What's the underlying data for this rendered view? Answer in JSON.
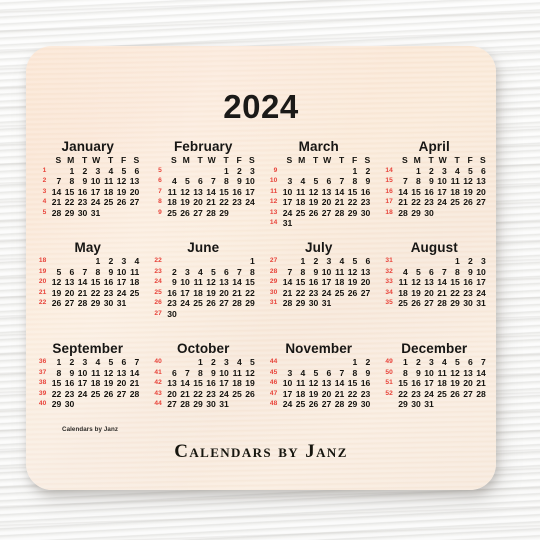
{
  "product": {
    "type": "mouse-pad",
    "pad_color": "#faead9",
    "background": "#f4f4f2"
  },
  "calendar": {
    "year": "2024",
    "week_number_color": "#e8433a",
    "text_color": "#14130f",
    "weekday_headers": [
      "S",
      "M",
      "T",
      "W",
      "T",
      "F",
      "S"
    ],
    "months": [
      {
        "name": "January",
        "show_weekday_header": true,
        "weeks": [
          {
            "num": "1",
            "days": [
              "",
              "1",
              "2",
              "3",
              "4",
              "5",
              "6"
            ]
          },
          {
            "num": "2",
            "days": [
              "7",
              "8",
              "9",
              "10",
              "11",
              "12",
              "13"
            ]
          },
          {
            "num": "3",
            "days": [
              "14",
              "15",
              "16",
              "17",
              "18",
              "19",
              "20"
            ]
          },
          {
            "num": "4",
            "days": [
              "21",
              "22",
              "23",
              "24",
              "25",
              "26",
              "27"
            ]
          },
          {
            "num": "5",
            "days": [
              "28",
              "29",
              "30",
              "31",
              "",
              "",
              ""
            ]
          }
        ]
      },
      {
        "name": "February",
        "show_weekday_header": true,
        "weeks": [
          {
            "num": "5",
            "days": [
              "",
              "",
              "",
              "",
              "1",
              "2",
              "3"
            ]
          },
          {
            "num": "6",
            "days": [
              "4",
              "5",
              "6",
              "7",
              "8",
              "9",
              "10"
            ]
          },
          {
            "num": "7",
            "days": [
              "11",
              "12",
              "13",
              "14",
              "15",
              "16",
              "17"
            ]
          },
          {
            "num": "8",
            "days": [
              "18",
              "19",
              "20",
              "21",
              "22",
              "23",
              "24"
            ]
          },
          {
            "num": "9",
            "days": [
              "25",
              "26",
              "27",
              "28",
              "29",
              "",
              ""
            ]
          }
        ]
      },
      {
        "name": "March",
        "show_weekday_header": true,
        "weeks": [
          {
            "num": "9",
            "days": [
              "",
              "",
              "",
              "",
              "",
              "1",
              "2"
            ]
          },
          {
            "num": "10",
            "days": [
              "3",
              "4",
              "5",
              "6",
              "7",
              "8",
              "9"
            ]
          },
          {
            "num": "11",
            "days": [
              "10",
              "11",
              "12",
              "13",
              "14",
              "15",
              "16"
            ]
          },
          {
            "num": "12",
            "days": [
              "17",
              "18",
              "19",
              "20",
              "21",
              "22",
              "23"
            ]
          },
          {
            "num": "13",
            "days": [
              "24",
              "25",
              "26",
              "27",
              "28",
              "29",
              "30"
            ]
          },
          {
            "num": "14",
            "days": [
              "31",
              "",
              "",
              "",
              "",
              "",
              ""
            ]
          }
        ]
      },
      {
        "name": "April",
        "show_weekday_header": true,
        "weeks": [
          {
            "num": "14",
            "days": [
              "",
              "1",
              "2",
              "3",
              "4",
              "5",
              "6"
            ]
          },
          {
            "num": "15",
            "days": [
              "7",
              "8",
              "9",
              "10",
              "11",
              "12",
              "13"
            ]
          },
          {
            "num": "16",
            "days": [
              "14",
              "15",
              "16",
              "17",
              "18",
              "19",
              "20"
            ]
          },
          {
            "num": "17",
            "days": [
              "21",
              "22",
              "23",
              "24",
              "25",
              "26",
              "27"
            ]
          },
          {
            "num": "18",
            "days": [
              "28",
              "29",
              "30",
              "",
              "",
              "",
              ""
            ]
          }
        ]
      },
      {
        "name": "May",
        "show_weekday_header": false,
        "weeks": [
          {
            "num": "18",
            "days": [
              "",
              "",
              "",
              "1",
              "2",
              "3",
              "4"
            ]
          },
          {
            "num": "19",
            "days": [
              "5",
              "6",
              "7",
              "8",
              "9",
              "10",
              "11"
            ]
          },
          {
            "num": "20",
            "days": [
              "12",
              "13",
              "14",
              "15",
              "16",
              "17",
              "18"
            ]
          },
          {
            "num": "21",
            "days": [
              "19",
              "20",
              "21",
              "22",
              "23",
              "24",
              "25"
            ]
          },
          {
            "num": "22",
            "days": [
              "26",
              "27",
              "28",
              "29",
              "30",
              "31",
              ""
            ]
          }
        ]
      },
      {
        "name": "June",
        "show_weekday_header": false,
        "weeks": [
          {
            "num": "22",
            "days": [
              "",
              "",
              "",
              "",
              "",
              "",
              "1"
            ]
          },
          {
            "num": "23",
            "days": [
              "2",
              "3",
              "4",
              "5",
              "6",
              "7",
              "8"
            ]
          },
          {
            "num": "24",
            "days": [
              "9",
              "10",
              "11",
              "12",
              "13",
              "14",
              "15"
            ]
          },
          {
            "num": "25",
            "days": [
              "16",
              "17",
              "18",
              "19",
              "20",
              "21",
              "22"
            ]
          },
          {
            "num": "26",
            "days": [
              "23",
              "24",
              "25",
              "26",
              "27",
              "28",
              "29"
            ]
          },
          {
            "num": "27",
            "days": [
              "30",
              "",
              "",
              "",
              "",
              "",
              ""
            ]
          }
        ]
      },
      {
        "name": "July",
        "show_weekday_header": false,
        "weeks": [
          {
            "num": "27",
            "days": [
              "",
              "1",
              "2",
              "3",
              "4",
              "5",
              "6"
            ]
          },
          {
            "num": "28",
            "days": [
              "7",
              "8",
              "9",
              "10",
              "11",
              "12",
              "13"
            ]
          },
          {
            "num": "29",
            "days": [
              "14",
              "15",
              "16",
              "17",
              "18",
              "19",
              "20"
            ]
          },
          {
            "num": "30",
            "days": [
              "21",
              "22",
              "23",
              "24",
              "25",
              "26",
              "27"
            ]
          },
          {
            "num": "31",
            "days": [
              "28",
              "29",
              "30",
              "31",
              "",
              "",
              ""
            ]
          }
        ]
      },
      {
        "name": "August",
        "show_weekday_header": false,
        "weeks": [
          {
            "num": "31",
            "days": [
              "",
              "",
              "",
              "",
              "1",
              "2",
              "3"
            ]
          },
          {
            "num": "32",
            "days": [
              "4",
              "5",
              "6",
              "7",
              "8",
              "9",
              "10"
            ]
          },
          {
            "num": "33",
            "days": [
              "11",
              "12",
              "13",
              "14",
              "15",
              "16",
              "17"
            ]
          },
          {
            "num": "34",
            "days": [
              "18",
              "19",
              "20",
              "21",
              "22",
              "23",
              "24"
            ]
          },
          {
            "num": "35",
            "days": [
              "25",
              "26",
              "27",
              "28",
              "29",
              "30",
              "31"
            ]
          }
        ]
      },
      {
        "name": "September",
        "show_weekday_header": false,
        "weeks": [
          {
            "num": "36",
            "days": [
              "1",
              "2",
              "3",
              "4",
              "5",
              "6",
              "7"
            ]
          },
          {
            "num": "37",
            "days": [
              "8",
              "9",
              "10",
              "11",
              "12",
              "13",
              "14"
            ]
          },
          {
            "num": "38",
            "days": [
              "15",
              "16",
              "17",
              "18",
              "19",
              "20",
              "21"
            ]
          },
          {
            "num": "39",
            "days": [
              "22",
              "23",
              "24",
              "25",
              "26",
              "27",
              "28"
            ]
          },
          {
            "num": "40",
            "days": [
              "29",
              "30",
              "",
              "",
              "",
              "",
              ""
            ]
          }
        ]
      },
      {
        "name": "October",
        "show_weekday_header": false,
        "weeks": [
          {
            "num": "40",
            "days": [
              "",
              "",
              "1",
              "2",
              "3",
              "4",
              "5"
            ]
          },
          {
            "num": "41",
            "days": [
              "6",
              "7",
              "8",
              "9",
              "10",
              "11",
              "12"
            ]
          },
          {
            "num": "42",
            "days": [
              "13",
              "14",
              "15",
              "16",
              "17",
              "18",
              "19"
            ]
          },
          {
            "num": "43",
            "days": [
              "20",
              "21",
              "22",
              "23",
              "24",
              "25",
              "26"
            ]
          },
          {
            "num": "44",
            "days": [
              "27",
              "28",
              "29",
              "30",
              "31",
              "",
              ""
            ]
          }
        ]
      },
      {
        "name": "November",
        "show_weekday_header": false,
        "weeks": [
          {
            "num": "44",
            "days": [
              "",
              "",
              "",
              "",
              "",
              "1",
              "2"
            ]
          },
          {
            "num": "45",
            "days": [
              "3",
              "4",
              "5",
              "6",
              "7",
              "8",
              "9"
            ]
          },
          {
            "num": "46",
            "days": [
              "10",
              "11",
              "12",
              "13",
              "14",
              "15",
              "16"
            ]
          },
          {
            "num": "47",
            "days": [
              "17",
              "18",
              "19",
              "20",
              "21",
              "22",
              "23"
            ]
          },
          {
            "num": "48",
            "days": [
              "24",
              "25",
              "26",
              "27",
              "28",
              "29",
              "30"
            ]
          }
        ]
      },
      {
        "name": "December",
        "show_weekday_header": false,
        "weeks": [
          {
            "num": "49",
            "days": [
              "1",
              "2",
              "3",
              "4",
              "5",
              "6",
              "7"
            ]
          },
          {
            "num": "50",
            "days": [
              "8",
              "9",
              "10",
              "11",
              "12",
              "13",
              "14"
            ]
          },
          {
            "num": "51",
            "days": [
              "15",
              "16",
              "17",
              "18",
              "19",
              "20",
              "21"
            ]
          },
          {
            "num": "52",
            "days": [
              "22",
              "23",
              "24",
              "25",
              "26",
              "27",
              "28"
            ]
          },
          {
            "num": "",
            "days": [
              "29",
              "30",
              "31",
              "",
              "",
              "",
              ""
            ]
          }
        ]
      }
    ]
  },
  "branding": {
    "small_credit": "Calendars by Janz",
    "main_credit": "Calendars by Janz"
  }
}
